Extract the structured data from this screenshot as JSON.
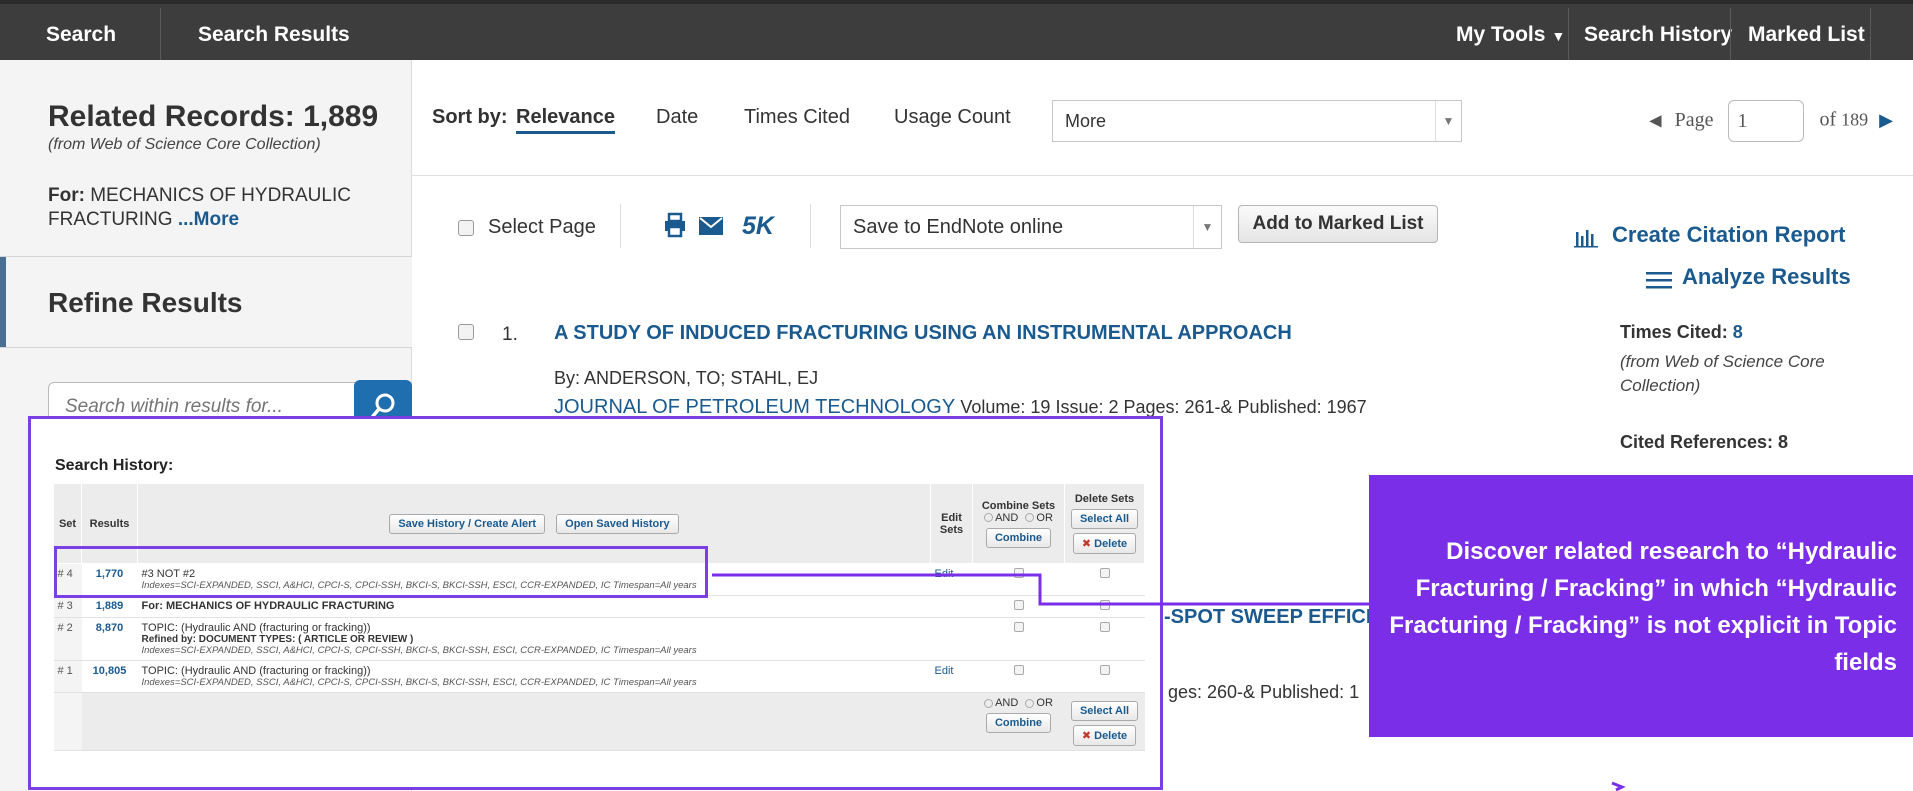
{
  "topbar": {
    "search": "Search",
    "search_results": "Search Results",
    "my_tools": "My Tools",
    "search_history": "Search History",
    "marked_list": "Marked List"
  },
  "sidebar": {
    "related_title": "Related Records: 1,889",
    "related_sub": "(from Web of Science Core Collection)",
    "for_label": "For:",
    "for_text": "MECHANICS OF HYDRAULIC FRACTURING",
    "for_more": "...More",
    "refine_title": "Refine Results",
    "search_placeholder": "Search within results for..."
  },
  "sortbar": {
    "label": "Sort by:",
    "options": [
      "Relevance",
      "Date",
      "Times Cited",
      "Usage Count"
    ],
    "more": "More",
    "page_label": "Page",
    "page_value": "1",
    "page_of": "of",
    "page_total": "189"
  },
  "toolbar": {
    "select_page": "Select Page",
    "fivek": "5K",
    "save_to": "Save to EndNote online",
    "add_marked": "Add to Marked List"
  },
  "right_panel": {
    "citation_report": "Create Citation Report",
    "analyze": "Analyze Results",
    "times_cited_label": "Times Cited:",
    "times_cited_value": "8",
    "times_cited_sub": "(from Web of Science Core Collection)",
    "cited_refs": "Cited References: 8"
  },
  "results": [
    {
      "num": "1.",
      "title": "A STUDY OF INDUCED FRACTURING USING AN INSTRUMENTAL APPROACH",
      "by": "By: ANDERSON, TO; STAHL, EJ",
      "journal": "JOURNAL OF PETROLEUM TECHNOLOGY",
      "meta": "Volume: 19   Issue: 2   Pages: 261-&   Published: 1967"
    },
    {
      "title": "-SPOT SWEEP EFFICIE",
      "meta": "ges: 260-&   Published: 1"
    }
  ],
  "search_history": {
    "title": "Search History:",
    "col_set": "Set",
    "col_results": "Results",
    "save_alert": "Save History / Create Alert",
    "open_saved": "Open Saved History",
    "col_edit": "Edit Sets",
    "col_combine": "Combine Sets",
    "col_delete": "Delete Sets",
    "and": "AND",
    "or": "OR",
    "combine": "Combine",
    "select_all": "Select All",
    "delete": "Delete",
    "edit": "Edit",
    "rows": [
      {
        "set": "# 4",
        "results": "1,770",
        "query": "#3 NOT #2",
        "refined": "",
        "indexes": "Indexes=SCI-EXPANDED, SSCI, A&HCI, CPCI-S, CPCI-SSH, BKCI-S, BKCI-SSH, ESCI, CCR-EXPANDED, IC Timespan=All years",
        "edit": "Edit"
      },
      {
        "set": "# 3",
        "results": "1,889",
        "query": "For: MECHANICS OF HYDRAULIC FRACTURING",
        "refined": "",
        "indexes": "",
        "edit": ""
      },
      {
        "set": "# 2",
        "results": "8,870",
        "query": "TOPIC: (Hydraulic AND (fracturing or fracking))",
        "refined": "Refined by: DOCUMENT TYPES: ( ARTICLE OR REVIEW )",
        "indexes": "Indexes=SCI-EXPANDED, SSCI, A&HCI, CPCI-S, CPCI-SSH, BKCI-S, BKCI-SSH, ESCI, CCR-EXPANDED, IC Timespan=All years",
        "edit": ""
      },
      {
        "set": "# 1",
        "results": "10,805",
        "query": "TOPIC: (Hydraulic AND (fracturing or fracking))",
        "refined": "",
        "indexes": "Indexes=SCI-EXPANDED, SSCI, A&HCI, CPCI-S, CPCI-SSH, BKCI-S, BKCI-SSH, ESCI, CCR-EXPANDED, IC Timespan=All years",
        "edit": "Edit"
      }
    ]
  },
  "callout": {
    "text": "Discover related research to “Hydraulic Fracturing / Fracking” in which “Hydraulic Fracturing / Fracking” is not explicit in Topic fields"
  },
  "colors": {
    "accent_purple": "#7a2ee8",
    "link_blue": "#1a5a8f",
    "topbar": "#3d3d3d"
  },
  "icons": [
    "search-icon",
    "print-icon",
    "mail-icon",
    "bar-chart-icon",
    "analyze-lines-icon",
    "page-prev-icon",
    "page-next-icon",
    "chevron-down-icon",
    "delete-x-icon"
  ]
}
